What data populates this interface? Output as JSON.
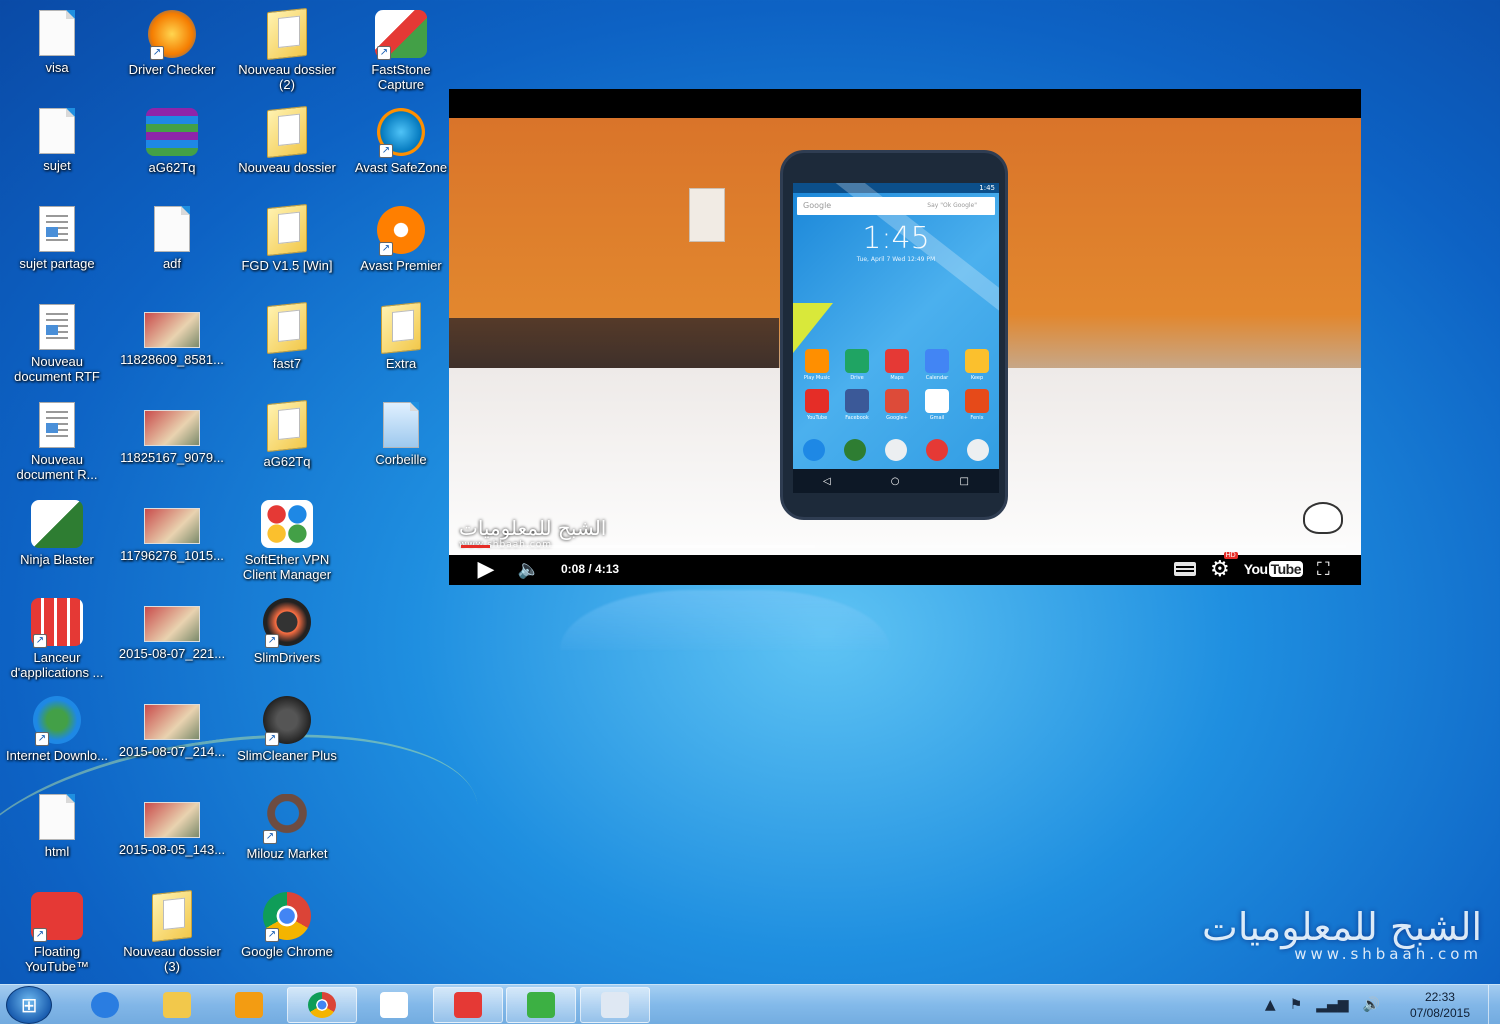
{
  "desktop": {
    "icons": [
      {
        "label": "visa",
        "icon": "text-document-icon",
        "shortcut": false
      },
      {
        "label": "Driver Checker",
        "icon": "driver-checker-icon",
        "shortcut": true
      },
      {
        "label": "Nouveau dossier (2)",
        "icon": "folder-icon",
        "shortcut": false
      },
      {
        "label": "FastStone Capture",
        "icon": "faststone-capture-icon",
        "shortcut": true
      },
      {
        "label": "sujet",
        "icon": "text-document-icon",
        "shortcut": false
      },
      {
        "label": "aG62Tq",
        "icon": "winrar-archive-icon",
        "shortcut": false
      },
      {
        "label": "Nouveau dossier",
        "icon": "folder-icon",
        "shortcut": false
      },
      {
        "label": "Avast SafeZone",
        "icon": "avast-safezone-icon",
        "shortcut": true
      },
      {
        "label": "sujet partage",
        "icon": "rtf-document-icon",
        "shortcut": false
      },
      {
        "label": "adf",
        "icon": "text-document-icon",
        "shortcut": false
      },
      {
        "label": "FGD V1.5 [Win]",
        "icon": "folder-icon",
        "shortcut": false
      },
      {
        "label": "Avast Premier",
        "icon": "avast-premier-icon",
        "shortcut": true
      },
      {
        "label": "Nouveau document RTF",
        "icon": "rtf-document-icon",
        "shortcut": false
      },
      {
        "label": "11828609_8581...",
        "icon": "image-thumbnail-icon",
        "shortcut": false
      },
      {
        "label": "fast7",
        "icon": "folder-icon",
        "shortcut": false
      },
      {
        "label": "Extra",
        "icon": "folder-icon",
        "shortcut": false
      },
      {
        "label": "Nouveau document R...",
        "icon": "rtf-document-icon",
        "shortcut": false
      },
      {
        "label": "11825167_9079...",
        "icon": "image-thumbnail-icon",
        "shortcut": false
      },
      {
        "label": "aG62Tq",
        "icon": "folder-icon",
        "shortcut": false
      },
      {
        "label": "Corbeille",
        "icon": "recycle-bin-icon",
        "shortcut": false
      },
      {
        "label": "Ninja Blaster",
        "icon": "ninja-blaster-icon",
        "shortcut": false
      },
      {
        "label": "11796276_1015...",
        "icon": "image-thumbnail-icon",
        "shortcut": false
      },
      {
        "label": "SoftEther VPN Client Manager",
        "icon": "softether-vpn-icon",
        "shortcut": false
      },
      {
        "label": "",
        "icon": "",
        "shortcut": false
      },
      {
        "label": "Lanceur d'applications ...",
        "icon": "app-launcher-icon",
        "shortcut": true
      },
      {
        "label": "2015-08-07_221...",
        "icon": "image-thumbnail-icon",
        "shortcut": false
      },
      {
        "label": "SlimDrivers",
        "icon": "slimdrivers-icon",
        "shortcut": true
      },
      {
        "label": "",
        "icon": "",
        "shortcut": false
      },
      {
        "label": "Internet Downlo...",
        "icon": "internet-download-manager-icon",
        "shortcut": true
      },
      {
        "label": "2015-08-07_214...",
        "icon": "image-thumbnail-icon",
        "shortcut": false
      },
      {
        "label": "SlimCleaner Plus",
        "icon": "slimcleaner-icon",
        "shortcut": true
      },
      {
        "label": "",
        "icon": "",
        "shortcut": false
      },
      {
        "label": "html",
        "icon": "text-document-icon",
        "shortcut": false
      },
      {
        "label": "2015-08-05_143...",
        "icon": "image-thumbnail-icon",
        "shortcut": false
      },
      {
        "label": "Milouz Market",
        "icon": "milouz-market-icon",
        "shortcut": true
      },
      {
        "label": "",
        "icon": "",
        "shortcut": false
      },
      {
        "label": "Floating YouTube™",
        "icon": "floating-youtube-icon",
        "shortcut": true
      },
      {
        "label": "Nouveau dossier (3)",
        "icon": "folder-icon",
        "shortcut": false
      },
      {
        "label": "Google Chrome",
        "icon": "chrome-icon",
        "shortcut": true
      }
    ]
  },
  "player": {
    "watermark_arabic": "الشبح للمعلوميات",
    "watermark_url": "www.shbaah.com",
    "time_display": "0:08 / 4:13",
    "progress_played_fraction": 0.033,
    "progress_buffered_fraction": 0.4,
    "hd_badge": "HD",
    "youtube_logo_you": "You",
    "youtube_logo_tube": "Tube",
    "phone": {
      "clock": "1:45",
      "date": "Tue, April 7   Wed 12:49 PM",
      "status_time": "1:45",
      "search_placeholder": "Google",
      "search_hint": "Say \"Ok Google\"",
      "apps_row1": [
        "Play Music",
        "Drive",
        "Maps",
        "Calendar",
        "Keep"
      ],
      "apps_row2": [
        "YouTube",
        "Facebook",
        "Google+",
        "Gmail",
        "Fenix"
      ],
      "app_colors_row1": [
        "#ff8f00",
        "#1fa463",
        "#e53935",
        "#4285f4",
        "#fbc02d"
      ],
      "app_colors_row2": [
        "#e52d27",
        "#3b5998",
        "#dd4b39",
        "#ffffff",
        "#e64a19"
      ],
      "dock_colors": [
        "#1e88e5",
        "#2e7d32",
        "#eceff1",
        "#e53935",
        "#eceff1"
      ]
    }
  },
  "desktop_watermark": {
    "arabic": "الشبح للمعلوميات",
    "url": "www.shbaah.com"
  },
  "taskbar": {
    "items": [
      {
        "name": "internet-explorer-icon",
        "color": "#2a7de1"
      },
      {
        "name": "file-explorer-icon",
        "color": "#f2c84b"
      },
      {
        "name": "media-player-icon",
        "color": "#f39c12"
      },
      {
        "name": "chrome-icon",
        "color": "#4285f4"
      },
      {
        "name": "app-launcher-icon",
        "color": "#ffffff"
      },
      {
        "name": "floating-youtube-icon",
        "color": "#e53935"
      },
      {
        "name": "checkmark-app-icon",
        "color": "#3cb043"
      },
      {
        "name": "document-viewer-icon",
        "color": "#dfe8f3"
      }
    ],
    "active_items": [
      3,
      5,
      6,
      7
    ],
    "clock_time": "22:33",
    "clock_date": "07/08/2015"
  }
}
